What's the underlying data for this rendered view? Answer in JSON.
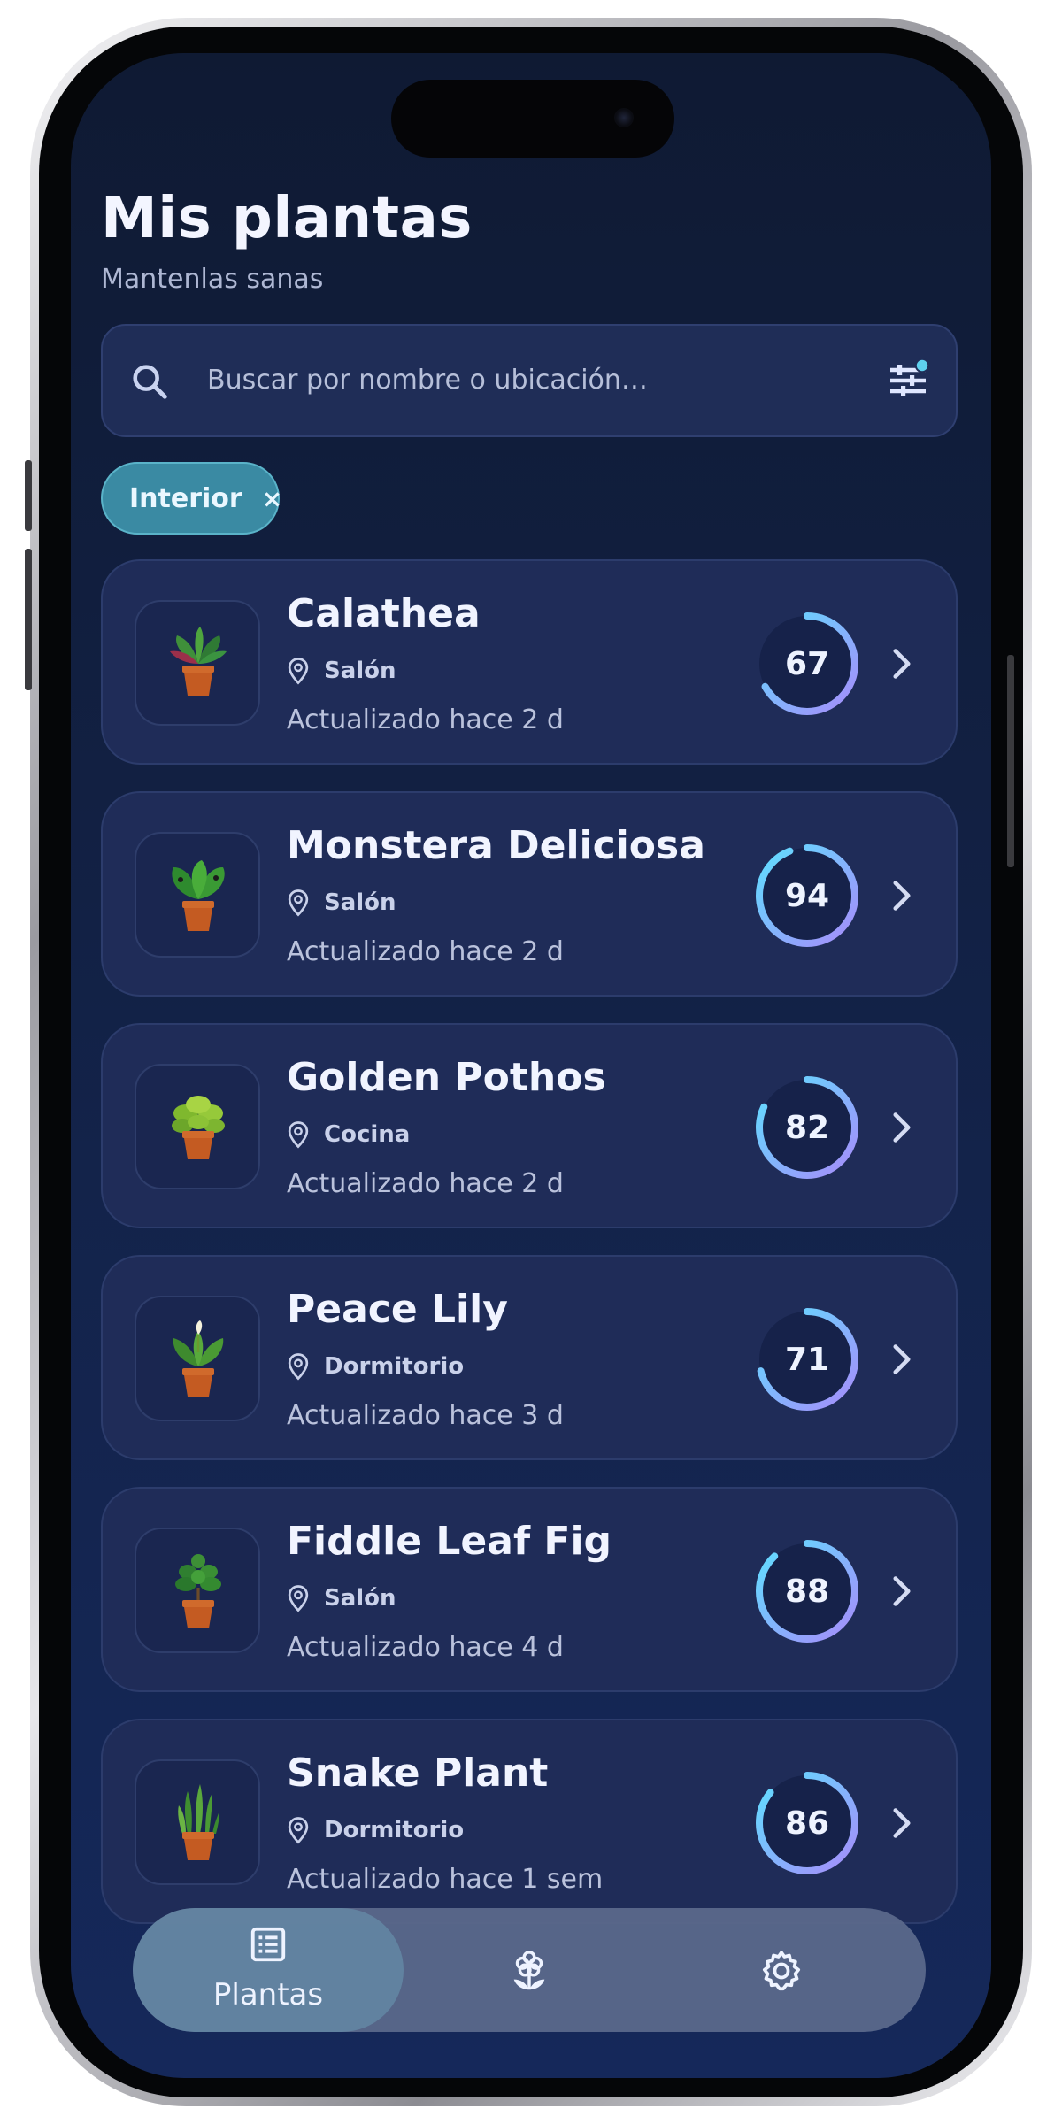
{
  "header": {
    "title": "Mis plantas",
    "subtitle": "Mantenlas sanas"
  },
  "search": {
    "placeholder": "Buscar por nombre o ubicación…",
    "icon": "search-icon",
    "filter_icon": "filter-sliders-icon"
  },
  "filters": {
    "active_chip": "Interior",
    "chip_remove": "×"
  },
  "plants": [
    {
      "name": "Calathea",
      "location": "Salón",
      "updated": "Actualizado hace 2 d",
      "score": "67",
      "score_value": 67
    },
    {
      "name": "Monstera Deliciosa",
      "location": "Salón",
      "updated": "Actualizado hace 2 d",
      "score": "94",
      "score_value": 94
    },
    {
      "name": "Golden Pothos",
      "location": "Cocina",
      "updated": "Actualizado hace 2 d",
      "score": "82",
      "score_value": 82
    },
    {
      "name": "Peace Lily",
      "location": "Dormitorio",
      "updated": "Actualizado hace 3 d",
      "score": "71",
      "score_value": 71
    },
    {
      "name": "Fiddle Leaf Fig",
      "location": "Salón",
      "updated": "Actualizado hace 4 d",
      "score": "88",
      "score_value": 88
    },
    {
      "name": "Snake Plant",
      "location": "Dormitorio",
      "updated": "Actualizado hace 1 sem",
      "score": "86",
      "score_value": 86
    }
  ],
  "nav": {
    "items": [
      {
        "label": "Plantas",
        "icon": "list-icon",
        "active": true
      },
      {
        "label": "",
        "icon": "flower-icon",
        "active": false
      },
      {
        "label": "",
        "icon": "gear-icon",
        "active": false
      }
    ]
  },
  "colors": {
    "background": "#13234a",
    "card": "#1f2c58",
    "ring_start": "#a78bfa",
    "ring_end": "#5ee0ff",
    "chip": "#3a8aa3"
  }
}
